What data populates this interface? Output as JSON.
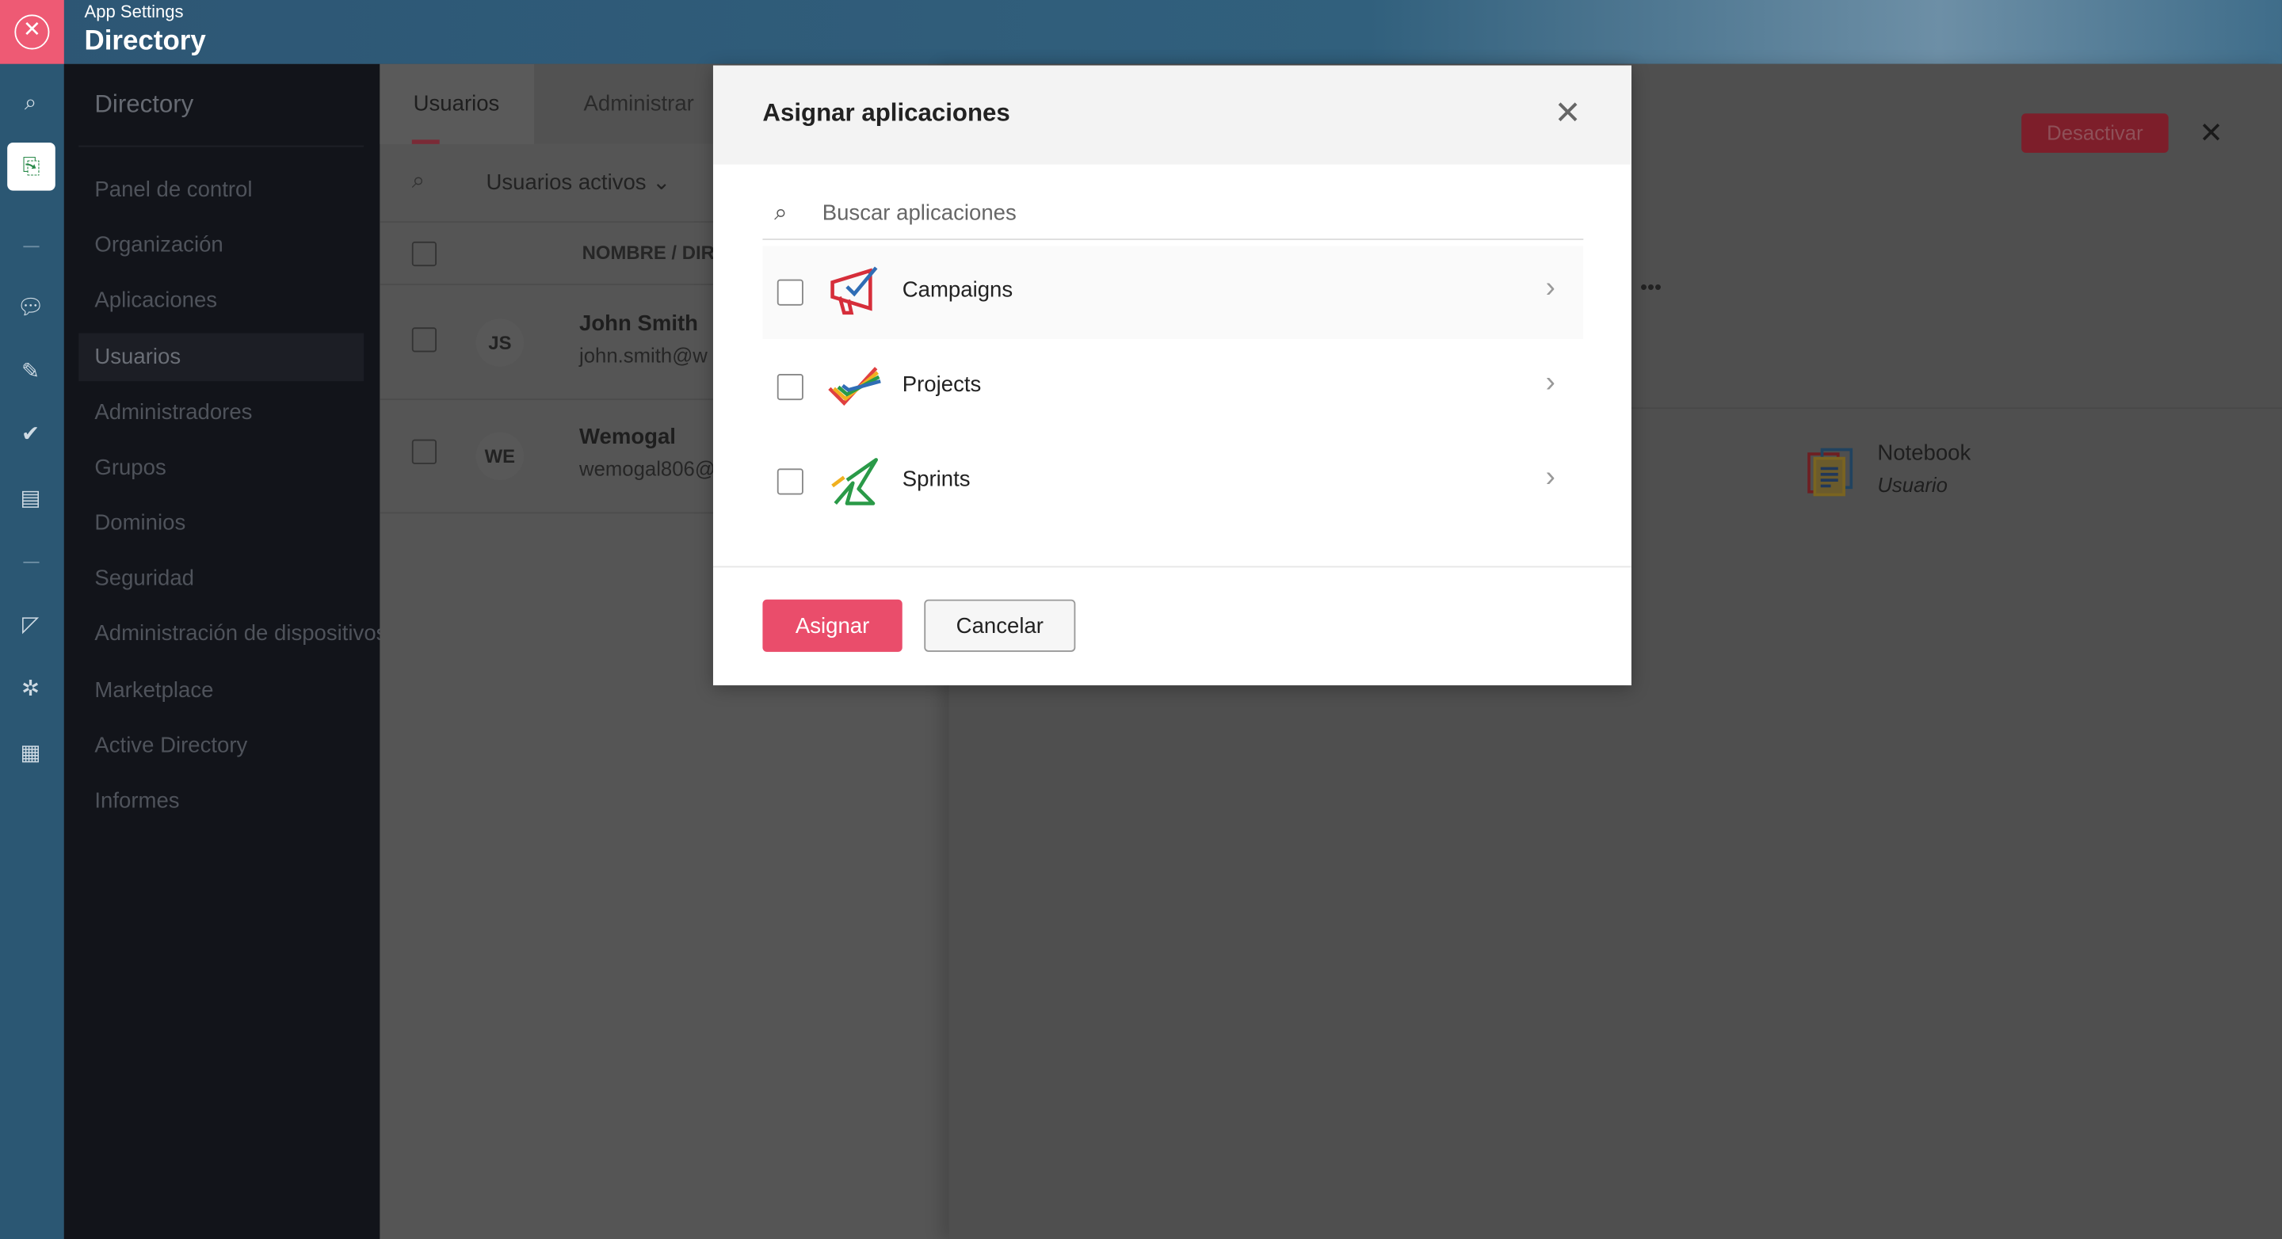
{
  "header": {
    "subtitle": "App Settings",
    "title": "Directory"
  },
  "rail": {
    "icons": [
      "search-icon",
      "directory-icon",
      "chat-icon",
      "sprints-icon",
      "projects-icon",
      "analytics-icon",
      "campaigns-icon",
      "settings-icon",
      "notebook-icon"
    ]
  },
  "sidebar": {
    "title": "Directory",
    "items": [
      {
        "label": "Panel de control"
      },
      {
        "label": "Organización"
      },
      {
        "label": "Aplicaciones"
      },
      {
        "label": "Usuarios",
        "selected": true
      },
      {
        "label": "Administradores"
      },
      {
        "label": "Grupos"
      },
      {
        "label": "Dominios"
      },
      {
        "label": "Seguridad"
      },
      {
        "label": "Administración de dispositivos"
      },
      {
        "label": "Marketplace"
      },
      {
        "label": "Active Directory"
      },
      {
        "label": "Informes"
      }
    ]
  },
  "main": {
    "tabs": [
      {
        "label": "Usuarios"
      },
      {
        "label": "Administrar"
      }
    ],
    "filter": "Usuarios activos",
    "column": "NOMBRE / DIRECCIÓN",
    "users": [
      {
        "initials": "JS",
        "name": "John Smith",
        "email": "john.smith@w"
      },
      {
        "initials": "WE",
        "name": "Wemogal",
        "email": "wemogal806@"
      }
    ]
  },
  "detail": {
    "deactivate": "Desactivar",
    "app_name": "Notebook",
    "app_role": "Usuario"
  },
  "modal": {
    "title": "Asignar aplicaciones",
    "search_placeholder": "Buscar aplicaciones",
    "apps": [
      {
        "label": "Campaigns",
        "checked": false
      },
      {
        "label": "Projects",
        "checked": false
      },
      {
        "label": "Sprints",
        "checked": false
      }
    ],
    "assign": "Asignar",
    "cancel": "Cancelar"
  },
  "colors": {
    "accent": "#ea4d6b",
    "header": "#2d5674"
  }
}
